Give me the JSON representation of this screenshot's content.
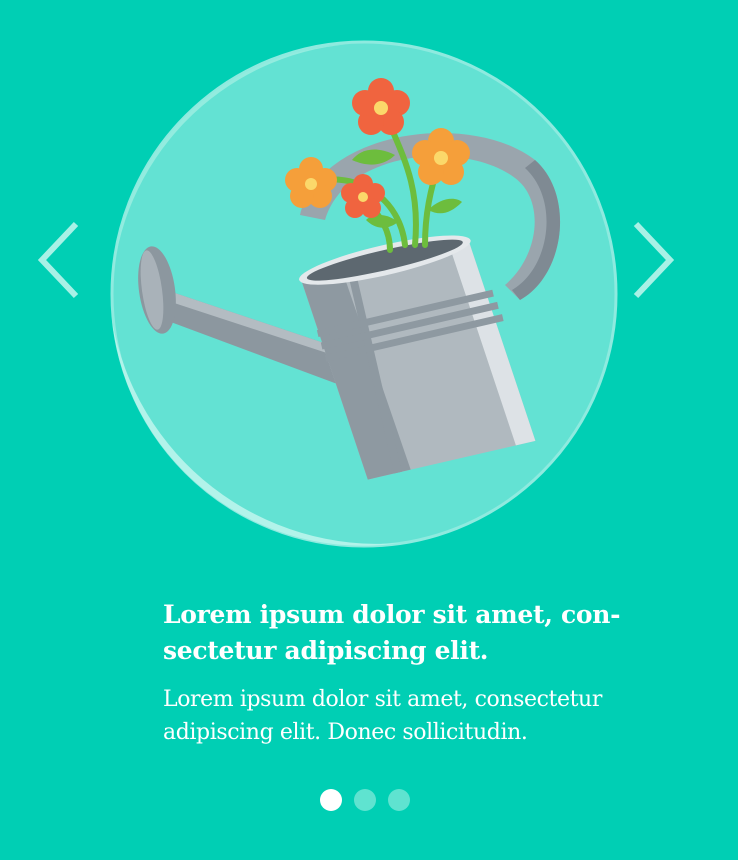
{
  "slide": {
    "title": "Lorem ipsum dolor sit amet, con-sectetur adipiscing elit.",
    "body": "Lorem ipsum dolor sit amet, consectetur adipiscing elit. Donec sollicitudin.",
    "illustration_icon": "watering-can-with-flowers-icon"
  },
  "navigation": {
    "prev_icon": "chevron-left-icon",
    "next_icon": "chevron-right-icon"
  },
  "pagination": {
    "total": 3,
    "active_index": 0
  },
  "colors": {
    "background": "#00cfb4",
    "bubble": "#5ce2d3",
    "arrow": "#a8f1e6",
    "dot_inactive": "#5fe3d0",
    "dot_active": "#ffffff",
    "flower_red": "#f0643f",
    "flower_orange": "#f59f3a"
  }
}
